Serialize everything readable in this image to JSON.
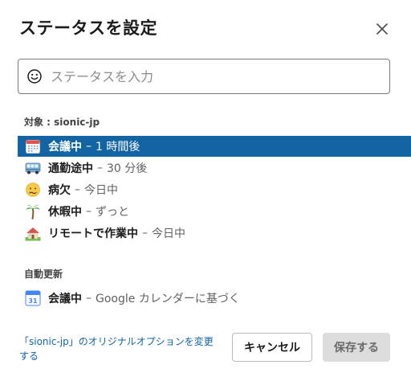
{
  "dialog": {
    "title": "ステータスを設定",
    "close_label": "×"
  },
  "search": {
    "placeholder": "ステータスを入力",
    "value": ""
  },
  "presets": {
    "label": "対象 : sionic-jp",
    "items": [
      {
        "icon": "calendar-icon",
        "name": "会議中",
        "sep": "–",
        "duration": "1 時間後",
        "selected": true
      },
      {
        "icon": "bus-icon",
        "name": "通勤途中",
        "sep": "–",
        "duration": "30 分後",
        "selected": false
      },
      {
        "icon": "sick-face-icon",
        "name": "病欠",
        "sep": "–",
        "duration": "今日中",
        "selected": false
      },
      {
        "icon": "palm-tree-icon",
        "name": "休暇中",
        "sep": "–",
        "duration": "ずっと",
        "selected": false
      },
      {
        "icon": "house-icon",
        "name": "リモートで作業中",
        "sep": "–",
        "duration": "今日中",
        "selected": false
      }
    ]
  },
  "auto_update": {
    "label": "自動更新",
    "items": [
      {
        "icon": "google-calendar-icon",
        "icon_text": "31",
        "name": "会議中",
        "sep": "–",
        "duration": "Google カレンダーに基づく"
      }
    ]
  },
  "footer": {
    "link": "「sionic-jp」のオリジナルオプションを変更する",
    "cancel": "キャンセル",
    "save": "保存する"
  },
  "colors": {
    "accent": "#1264a3",
    "save_disabled_bg": "#dddcdd"
  }
}
